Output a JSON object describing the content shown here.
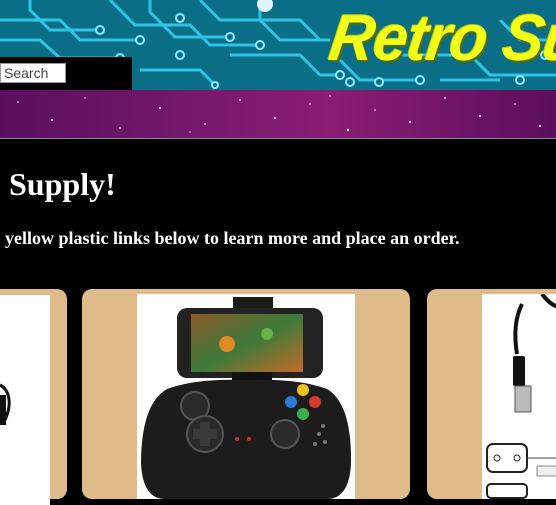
{
  "header": {
    "brand": "Retro Su"
  },
  "search": {
    "placeholder": "Search"
  },
  "page": {
    "title": "Supply!",
    "lead": "yellow plastic links below to learn more and place an order."
  },
  "products": [
    {
      "image": "controller-cable-image"
    },
    {
      "image": "mobile-gamepad-image"
    },
    {
      "image": "usb-adapter-image"
    }
  ]
}
